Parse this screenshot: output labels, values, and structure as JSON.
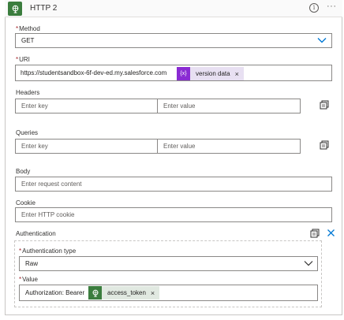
{
  "header": {
    "title": "HTTP 2",
    "icon": "globe-icon",
    "info_icon": "info-icon",
    "more_icon": "more-icon",
    "more_label": "···",
    "accent": "#3b7d3e"
  },
  "method": {
    "label": "Method",
    "value": "GET"
  },
  "uri": {
    "label": "URI",
    "value": "https://studentsandbox-6f-dev-ed.my.salesforce.com",
    "token": {
      "icon": "{x}",
      "label": "version data",
      "color": "#8a2bd3"
    }
  },
  "headers": {
    "label": "Headers",
    "key_placeholder": "Enter key",
    "value_placeholder": "Enter value"
  },
  "queries": {
    "label": "Queries",
    "key_placeholder": "Enter key",
    "value_placeholder": "Enter value"
  },
  "body": {
    "label": "Body",
    "placeholder": "Enter request content"
  },
  "cookie": {
    "label": "Cookie",
    "placeholder": "Enter HTTP cookie"
  },
  "authentication": {
    "label": "Authentication",
    "type_label": "Authentication type",
    "type_value": "Raw",
    "value_label": "Value",
    "value_text": "Authorization: Bearer",
    "token": {
      "label": "access_token",
      "color": "#3b7d3e"
    }
  },
  "token_close": "×"
}
